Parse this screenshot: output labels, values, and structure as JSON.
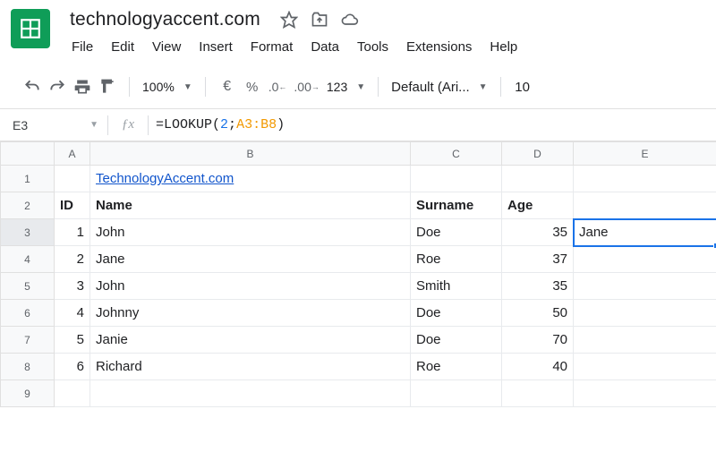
{
  "doc": {
    "title": "technologyaccent.com"
  },
  "menu": {
    "file": "File",
    "edit": "Edit",
    "view": "View",
    "insert": "Insert",
    "format": "Format",
    "data": "Data",
    "tools": "Tools",
    "extensions": "Extensions",
    "help": "Help"
  },
  "toolbar": {
    "zoom": "100%",
    "currency": "€",
    "percent": "%",
    "dec_dec": ".0",
    "dec_inc": ".00",
    "numfmt": "123",
    "font": "Default (Ari...",
    "fontsize": "10"
  },
  "fbar": {
    "name": "E3",
    "fx": "ƒx",
    "formula": {
      "fn": "=LOOKUP",
      "open": "(",
      "arg1": "2",
      "sep": ";",
      "arg2": "A3:B8",
      "close": ")"
    }
  },
  "cols": {
    "A": "A",
    "B": "B",
    "C": "C",
    "D": "D",
    "E": "E"
  },
  "rows": {
    "r1": "1",
    "r2": "2",
    "r3": "3",
    "r4": "4",
    "r5": "5",
    "r6": "6",
    "r7": "7",
    "r8": "8",
    "r9": "9"
  },
  "cells": {
    "B1": "TechnologyAccent.com",
    "A2": "ID",
    "B2": "Name",
    "C2": "Surname",
    "D2": "Age",
    "A3": "1",
    "B3": "John",
    "C3": "Doe",
    "D3": "35",
    "E3": "Jane",
    "A4": "2",
    "B4": "Jane",
    "C4": "Roe",
    "D4": "37",
    "A5": "3",
    "B5": "John",
    "C5": "Smith",
    "D5": "35",
    "A6": "4",
    "B6": "Johnny",
    "C6": "Doe",
    "D6": "50",
    "A7": "5",
    "B7": "Janie",
    "C7": "Doe",
    "D7": "70",
    "A8": "6",
    "B8": "Richard",
    "C8": "Roe",
    "D8": "40"
  }
}
